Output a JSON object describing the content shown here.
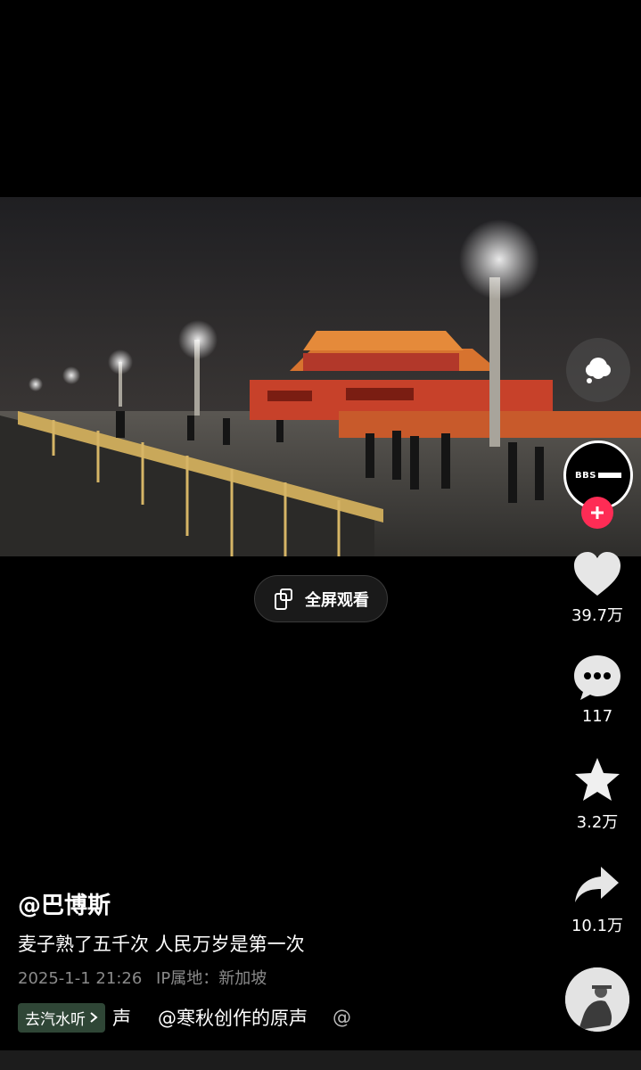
{
  "video": {
    "fullscreen_label": "全屏观看"
  },
  "actions": {
    "like_count": "39.7万",
    "comment_count": "117",
    "favorite_count": "3.2万",
    "share_count": "10.1万"
  },
  "author": {
    "handle": "@巴博斯",
    "avatar_logo": "BBS"
  },
  "post": {
    "description": "麦子熟了五千次 人民万岁是第一次",
    "date": "2025-1-1 21:26",
    "ip_location": "IP属地：新加坡"
  },
  "music": {
    "tag_label": "去汽水听",
    "tail_char": "声",
    "source": "@寒秋创作的原声",
    "next_char": "@"
  },
  "icons": [
    "fullscreen-icon",
    "thought-bubble-icon",
    "plus-icon",
    "heart-icon",
    "comment-icon",
    "star-icon",
    "share-icon",
    "chevron-right-icon"
  ],
  "colors": {
    "follow_red": "#fe2c55",
    "tag_green": "#2f4636",
    "meta_gray": "#8a8a8a"
  }
}
